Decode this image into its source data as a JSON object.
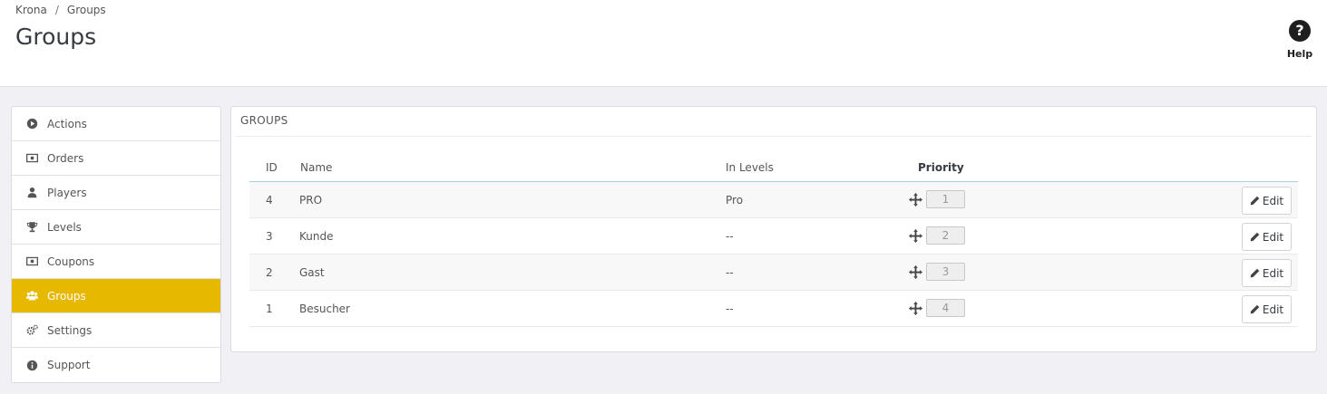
{
  "breadcrumb": {
    "root": "Krona",
    "separator": "/",
    "current": "Groups"
  },
  "page": {
    "title": "Groups"
  },
  "help": {
    "icon": "question-circle-icon",
    "label": "Help"
  },
  "sidebar": {
    "active_color": "#e6b800",
    "items": [
      {
        "label": "Actions",
        "icon": "play-circle-icon"
      },
      {
        "label": "Orders",
        "icon": "money-icon"
      },
      {
        "label": "Players",
        "icon": "user-icon"
      },
      {
        "label": "Levels",
        "icon": "trophy-icon"
      },
      {
        "label": "Coupons",
        "icon": "money-icon"
      },
      {
        "label": "Groups",
        "icon": "users-icon",
        "active": true
      },
      {
        "label": "Settings",
        "icon": "cogs-icon"
      },
      {
        "label": "Support",
        "icon": "info-circle-icon"
      }
    ]
  },
  "panel": {
    "heading": "GROUPS",
    "columns": {
      "id": "ID",
      "name": "Name",
      "levels": "In Levels",
      "priority": "Priority"
    },
    "rows": [
      {
        "id": "4",
        "name": "PRO",
        "levels": "Pro",
        "priority": "1",
        "edit_label": "Edit"
      },
      {
        "id": "3",
        "name": "Kunde",
        "levels": "--",
        "priority": "2",
        "edit_label": "Edit"
      },
      {
        "id": "2",
        "name": "Gast",
        "levels": "--",
        "priority": "3",
        "edit_label": "Edit"
      },
      {
        "id": "1",
        "name": "Besucher",
        "levels": "--",
        "priority": "4",
        "edit_label": "Edit"
      }
    ]
  }
}
